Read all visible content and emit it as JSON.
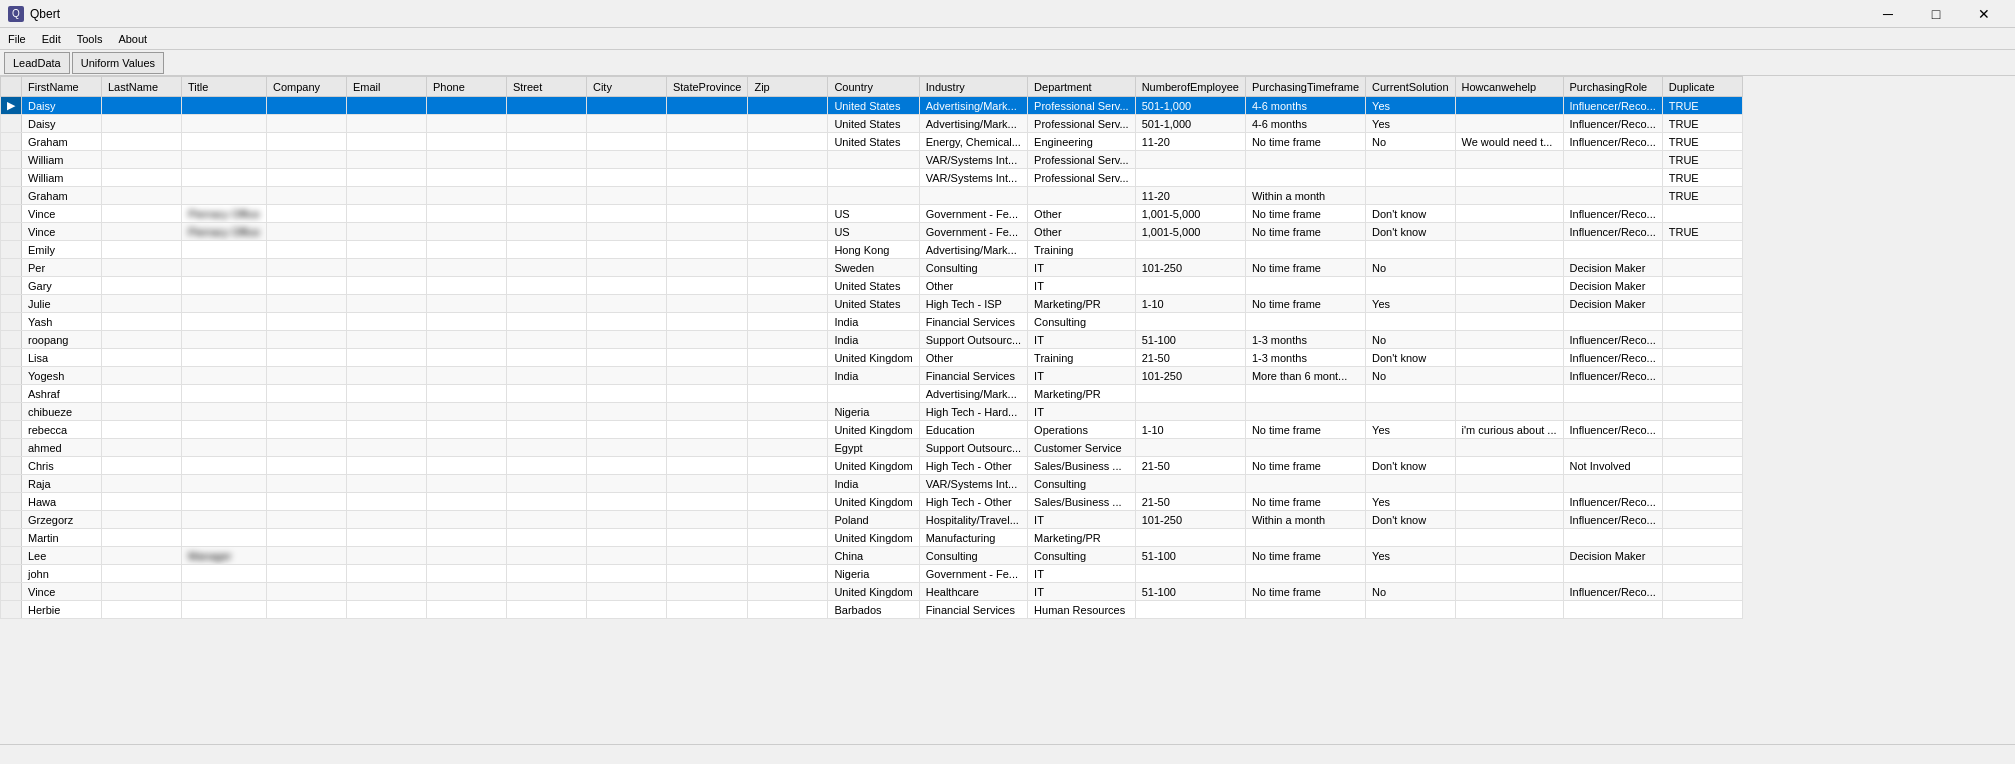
{
  "app": {
    "title": "Qbert",
    "icon": "Q"
  },
  "titlebar": {
    "minimize": "─",
    "maximize": "□",
    "close": "✕"
  },
  "menu": {
    "items": [
      "File",
      "Edit",
      "Tools",
      "About"
    ]
  },
  "toolbar": {
    "buttons": [
      "LeadData",
      "Uniform Values"
    ]
  },
  "table": {
    "columns": [
      "",
      "FirstName",
      "LastName",
      "Title",
      "Company",
      "Email",
      "Phone",
      "Street",
      "City",
      "StateProvince",
      "Zip",
      "Country",
      "Industry",
      "Department",
      "NumberofEmployee",
      "PurchasingTimeframe",
      "CurrentSolution",
      "Howcanwehelp",
      "PurchasingRole",
      "Duplicate"
    ],
    "rows": [
      {
        "sel": true,
        "indicator": "▶",
        "FirstName": "Daisy",
        "LastName": "",
        "Title": "",
        "Company": "",
        "Email": "",
        "Phone": "",
        "Street": "",
        "City": "",
        "StateProvince": "",
        "Zip": "",
        "Country": "United States",
        "Industry": "Advertising/Mark...",
        "Department": "Professional Serv...",
        "NumberofEmployee": "501-1,000",
        "PurchasingTimeframe": "4-6 months",
        "CurrentSolution": "Yes",
        "Howcanwehelp": "",
        "PurchasingRole": "Influencer/Reco...",
        "Duplicate": "TRUE"
      },
      {
        "indicator": "",
        "FirstName": "Daisy",
        "LastName": "",
        "Title": "",
        "Company": "",
        "Email": "",
        "Phone": "",
        "Street": "",
        "City": "",
        "StateProvince": "",
        "Zip": "",
        "Country": "United States",
        "Industry": "Advertising/Mark...",
        "Department": "Professional Serv...",
        "NumberofEmployee": "501-1,000",
        "PurchasingTimeframe": "4-6 months",
        "CurrentSolution": "Yes",
        "Howcanwehelp": "",
        "PurchasingRole": "Influencer/Reco...",
        "Duplicate": "TRUE"
      },
      {
        "indicator": "",
        "FirstName": "Graham",
        "LastName": "",
        "Title": "",
        "Company": "",
        "Email": "",
        "Phone": "",
        "Street": "",
        "City": "",
        "StateProvince": "",
        "Zip": "",
        "Country": "United States",
        "Industry": "Energy, Chemical...",
        "Department": "Engineering",
        "NumberofEmployee": "11-20",
        "PurchasingTimeframe": "No time frame",
        "CurrentSolution": "No",
        "Howcanwehelp": "We would need t...",
        "PurchasingRole": "Influencer/Reco...",
        "Duplicate": "TRUE"
      },
      {
        "indicator": "",
        "FirstName": "William",
        "LastName": "",
        "Title": "",
        "Company": "",
        "Email": "",
        "Phone": "",
        "Street": "",
        "City": "",
        "StateProvince": "",
        "Zip": "",
        "Country": "",
        "Industry": "VAR/Systems Int...",
        "Department": "Professional Serv...",
        "NumberofEmployee": "",
        "PurchasingTimeframe": "",
        "CurrentSolution": "",
        "Howcanwehelp": "",
        "PurchasingRole": "",
        "Duplicate": "TRUE"
      },
      {
        "indicator": "",
        "FirstName": "William",
        "LastName": "",
        "Title": "",
        "Company": "",
        "Email": "",
        "Phone": "",
        "Street": "",
        "City": "",
        "StateProvince": "",
        "Zip": "",
        "Country": "",
        "Industry": "VAR/Systems Int...",
        "Department": "Professional Serv...",
        "NumberofEmployee": "",
        "PurchasingTimeframe": "",
        "CurrentSolution": "",
        "Howcanwehelp": "",
        "PurchasingRole": "",
        "Duplicate": "TRUE"
      },
      {
        "indicator": "",
        "FirstName": "Graham",
        "LastName": "",
        "Title": "",
        "Company": "",
        "Email": "",
        "Phone": "",
        "Street": "",
        "City": "",
        "StateProvince": "",
        "Zip": "",
        "Country": "",
        "Industry": "",
        "Department": "",
        "NumberofEmployee": "11-20",
        "PurchasingTimeframe": "Within a month",
        "CurrentSolution": "",
        "Howcanwehelp": "",
        "PurchasingRole": "",
        "Duplicate": "TRUE"
      },
      {
        "indicator": "",
        "FirstName": "Vince",
        "LastName": "",
        "Title": "Pierracy Office",
        "Company": "",
        "Email": "",
        "Phone": "",
        "Street": "",
        "City": "",
        "StateProvince": "",
        "Zip": "",
        "Country": "US",
        "Industry": "Government - Fe...",
        "Department": "Other",
        "NumberofEmployee": "1,001-5,000",
        "PurchasingTimeframe": "No time frame",
        "CurrentSolution": "Don't know",
        "Howcanwehelp": "",
        "PurchasingRole": "Influencer/Reco...",
        "Duplicate": ""
      },
      {
        "indicator": "",
        "FirstName": "Vince",
        "LastName": "",
        "Title": "Pierracy Office",
        "Company": "",
        "Email": "",
        "Phone": "",
        "Street": "",
        "City": "",
        "StateProvince": "",
        "Zip": "",
        "Country": "US",
        "Industry": "Government - Fe...",
        "Department": "Other",
        "NumberofEmployee": "1,001-5,000",
        "PurchasingTimeframe": "No time frame",
        "CurrentSolution": "Don't know",
        "Howcanwehelp": "",
        "PurchasingRole": "Influencer/Reco...",
        "Duplicate": "TRUE"
      },
      {
        "indicator": "",
        "FirstName": "Emily",
        "LastName": "",
        "Title": "",
        "Company": "",
        "Email": "",
        "Phone": "",
        "Street": "",
        "City": "",
        "StateProvince": "",
        "Zip": "",
        "Country": "Hong Kong",
        "Industry": "Advertising/Mark...",
        "Department": "Training",
        "NumberofEmployee": "",
        "PurchasingTimeframe": "",
        "CurrentSolution": "",
        "Howcanwehelp": "",
        "PurchasingRole": "",
        "Duplicate": ""
      },
      {
        "indicator": "",
        "FirstName": "Per",
        "LastName": "",
        "Title": "",
        "Company": "",
        "Email": "",
        "Phone": "",
        "Street": "",
        "City": "",
        "StateProvince": "",
        "Zip": "",
        "Country": "Sweden",
        "Industry": "Consulting",
        "Department": "IT",
        "NumberofEmployee": "101-250",
        "PurchasingTimeframe": "No time frame",
        "CurrentSolution": "No",
        "Howcanwehelp": "",
        "PurchasingRole": "Decision Maker",
        "Duplicate": ""
      },
      {
        "indicator": "",
        "FirstName": "Gary",
        "LastName": "",
        "Title": "",
        "Company": "",
        "Email": "",
        "Phone": "",
        "Street": "",
        "City": "",
        "StateProvince": "",
        "Zip": "",
        "Country": "United States",
        "Industry": "Other",
        "Department": "IT",
        "NumberofEmployee": "",
        "PurchasingTimeframe": "",
        "CurrentSolution": "",
        "Howcanwehelp": "",
        "PurchasingRole": "Decision Maker",
        "Duplicate": ""
      },
      {
        "indicator": "",
        "FirstName": "Julie",
        "LastName": "",
        "Title": "",
        "Company": "",
        "Email": "",
        "Phone": "",
        "Street": "",
        "City": "",
        "StateProvince": "",
        "Zip": "",
        "Country": "United States",
        "Industry": "High Tech - ISP",
        "Department": "Marketing/PR",
        "NumberofEmployee": "1-10",
        "PurchasingTimeframe": "No time frame",
        "CurrentSolution": "Yes",
        "Howcanwehelp": "",
        "PurchasingRole": "Decision Maker",
        "Duplicate": ""
      },
      {
        "indicator": "",
        "FirstName": "Yash",
        "LastName": "",
        "Title": "",
        "Company": "",
        "Email": "",
        "Phone": "",
        "Street": "",
        "City": "",
        "StateProvince": "",
        "Zip": "",
        "Country": "India",
        "Industry": "Financial Services",
        "Department": "Consulting",
        "NumberofEmployee": "",
        "PurchasingTimeframe": "",
        "CurrentSolution": "",
        "Howcanwehelp": "",
        "PurchasingRole": "",
        "Duplicate": ""
      },
      {
        "indicator": "",
        "FirstName": "roopang",
        "LastName": "",
        "Title": "",
        "Company": "",
        "Email": "",
        "Phone": "",
        "Street": "",
        "City": "",
        "StateProvince": "",
        "Zip": "",
        "Country": "India",
        "Industry": "Support Outsourc...",
        "Department": "IT",
        "NumberofEmployee": "51-100",
        "PurchasingTimeframe": "1-3 months",
        "CurrentSolution": "No",
        "Howcanwehelp": "",
        "PurchasingRole": "Influencer/Reco...",
        "Duplicate": ""
      },
      {
        "indicator": "",
        "FirstName": "Lisa",
        "LastName": "",
        "Title": "",
        "Company": "",
        "Email": "",
        "Phone": "",
        "Street": "",
        "City": "",
        "StateProvince": "",
        "Zip": "",
        "Country": "United Kingdom",
        "Industry": "Other",
        "Department": "Training",
        "NumberofEmployee": "21-50",
        "PurchasingTimeframe": "1-3 months",
        "CurrentSolution": "Don't know",
        "Howcanwehelp": "",
        "PurchasingRole": "Influencer/Reco...",
        "Duplicate": ""
      },
      {
        "indicator": "",
        "FirstName": "Yogesh",
        "LastName": "",
        "Title": "",
        "Company": "",
        "Email": "",
        "Phone": "",
        "Street": "",
        "City": "",
        "StateProvince": "",
        "Zip": "",
        "Country": "India",
        "Industry": "Financial Services",
        "Department": "IT",
        "NumberofEmployee": "101-250",
        "PurchasingTimeframe": "More than 6 mont...",
        "CurrentSolution": "No",
        "Howcanwehelp": "",
        "PurchasingRole": "Influencer/Reco...",
        "Duplicate": ""
      },
      {
        "indicator": "",
        "FirstName": "Ashraf",
        "LastName": "",
        "Title": "",
        "Company": "",
        "Email": "",
        "Phone": "",
        "Street": "",
        "City": "",
        "StateProvince": "",
        "Zip": "",
        "Country": "",
        "Industry": "Advertising/Mark...",
        "Department": "Marketing/PR",
        "NumberofEmployee": "",
        "PurchasingTimeframe": "",
        "CurrentSolution": "",
        "Howcanwehelp": "",
        "PurchasingRole": "",
        "Duplicate": ""
      },
      {
        "indicator": "",
        "FirstName": "chibueze",
        "LastName": "",
        "Title": "",
        "Company": "",
        "Email": "",
        "Phone": "",
        "Street": "",
        "City": "",
        "StateProvince": "",
        "Zip": "",
        "Country": "Nigeria",
        "Industry": "High Tech - Hard...",
        "Department": "IT",
        "NumberofEmployee": "",
        "PurchasingTimeframe": "",
        "CurrentSolution": "",
        "Howcanwehelp": "",
        "PurchasingRole": "",
        "Duplicate": ""
      },
      {
        "indicator": "",
        "FirstName": "rebecca",
        "LastName": "",
        "Title": "",
        "Company": "",
        "Email": "",
        "Phone": "",
        "Street": "",
        "City": "",
        "StateProvince": "",
        "Zip": "",
        "Country": "United Kingdom",
        "Industry": "Education",
        "Department": "Operations",
        "NumberofEmployee": "1-10",
        "PurchasingTimeframe": "No time frame",
        "CurrentSolution": "Yes",
        "Howcanwehelp": "i'm curious about ...",
        "PurchasingRole": "Influencer/Reco...",
        "Duplicate": ""
      },
      {
        "indicator": "",
        "FirstName": "ahmed",
        "LastName": "",
        "Title": "",
        "Company": "",
        "Email": "",
        "Phone": "",
        "Street": "",
        "City": "",
        "StateProvince": "",
        "Zip": "",
        "Country": "Egypt",
        "Industry": "Support Outsourc...",
        "Department": "Customer Service",
        "NumberofEmployee": "",
        "PurchasingTimeframe": "",
        "CurrentSolution": "",
        "Howcanwehelp": "",
        "PurchasingRole": "",
        "Duplicate": ""
      },
      {
        "indicator": "",
        "FirstName": "Chris",
        "LastName": "",
        "Title": "",
        "Company": "",
        "Email": "",
        "Phone": "",
        "Street": "",
        "City": "",
        "StateProvince": "",
        "Zip": "",
        "Country": "United Kingdom",
        "Industry": "High Tech - Other",
        "Department": "Sales/Business ...",
        "NumberofEmployee": "21-50",
        "PurchasingTimeframe": "No time frame",
        "CurrentSolution": "Don't know",
        "Howcanwehelp": "",
        "PurchasingRole": "Not Involved",
        "Duplicate": ""
      },
      {
        "indicator": "",
        "FirstName": "Raja",
        "LastName": "",
        "Title": "",
        "Company": "",
        "Email": "",
        "Phone": "",
        "Street": "",
        "City": "",
        "StateProvince": "",
        "Zip": "",
        "Country": "India",
        "Industry": "VAR/Systems Int...",
        "Department": "Consulting",
        "NumberofEmployee": "",
        "PurchasingTimeframe": "",
        "CurrentSolution": "",
        "Howcanwehelp": "",
        "PurchasingRole": "",
        "Duplicate": ""
      },
      {
        "indicator": "",
        "FirstName": "Hawa",
        "LastName": "",
        "Title": "",
        "Company": "",
        "Email": "",
        "Phone": "",
        "Street": "",
        "City": "",
        "StateProvince": "",
        "Zip": "",
        "Country": "United Kingdom",
        "Industry": "High Tech - Other",
        "Department": "Sales/Business ...",
        "NumberofEmployee": "21-50",
        "PurchasingTimeframe": "No time frame",
        "CurrentSolution": "Yes",
        "Howcanwehelp": "",
        "PurchasingRole": "Influencer/Reco...",
        "Duplicate": ""
      },
      {
        "indicator": "",
        "FirstName": "Grzegorz",
        "LastName": "",
        "Title": "",
        "Company": "",
        "Email": "",
        "Phone": "",
        "Street": "",
        "City": "",
        "StateProvince": "",
        "Zip": "",
        "Country": "Poland",
        "Industry": "Hospitality/Travel...",
        "Department": "IT",
        "NumberofEmployee": "101-250",
        "PurchasingTimeframe": "Within a month",
        "CurrentSolution": "Don't know",
        "Howcanwehelp": "",
        "PurchasingRole": "Influencer/Reco...",
        "Duplicate": ""
      },
      {
        "indicator": "",
        "FirstName": "Martin",
        "LastName": "",
        "Title": "",
        "Company": "",
        "Email": "",
        "Phone": "",
        "Street": "",
        "City": "",
        "StateProvince": "",
        "Zip": "",
        "Country": "United Kingdom",
        "Industry": "Manufacturing",
        "Department": "Marketing/PR",
        "NumberofEmployee": "",
        "PurchasingTimeframe": "",
        "CurrentSolution": "",
        "Howcanwehelp": "",
        "PurchasingRole": "",
        "Duplicate": ""
      },
      {
        "indicator": "",
        "FirstName": "Lee",
        "LastName": "",
        "Title": "Manager",
        "Company": "",
        "Email": "",
        "Phone": "",
        "Street": "",
        "City": "",
        "StateProvince": "",
        "Zip": "",
        "Country": "China",
        "Industry": "Consulting",
        "Department": "Consulting",
        "NumberofEmployee": "51-100",
        "PurchasingTimeframe": "No time frame",
        "CurrentSolution": "Yes",
        "Howcanwehelp": "",
        "PurchasingRole": "Decision Maker",
        "Duplicate": ""
      },
      {
        "indicator": "",
        "FirstName": "john",
        "LastName": "",
        "Title": "",
        "Company": "",
        "Email": "",
        "Phone": "",
        "Street": "",
        "City": "",
        "StateProvince": "",
        "Zip": "",
        "Country": "Nigeria",
        "Industry": "Government - Fe...",
        "Department": "IT",
        "NumberofEmployee": "",
        "PurchasingTimeframe": "",
        "CurrentSolution": "",
        "Howcanwehelp": "",
        "PurchasingRole": "",
        "Duplicate": ""
      },
      {
        "indicator": "",
        "FirstName": "Vince",
        "LastName": "",
        "Title": "",
        "Company": "",
        "Email": "",
        "Phone": "",
        "Street": "",
        "City": "",
        "StateProvince": "",
        "Zip": "",
        "Country": "United Kingdom",
        "Industry": "Healthcare",
        "Department": "IT",
        "NumberofEmployee": "51-100",
        "PurchasingTimeframe": "No time frame",
        "CurrentSolution": "No",
        "Howcanwehelp": "",
        "PurchasingRole": "Influencer/Reco...",
        "Duplicate": ""
      },
      {
        "indicator": "",
        "FirstName": "Herbie",
        "LastName": "",
        "Title": "",
        "Company": "",
        "Email": "",
        "Phone": "",
        "Street": "",
        "City": "",
        "StateProvince": "",
        "Zip": "",
        "Country": "Barbados",
        "Industry": "Financial Services",
        "Department": "Human Resources",
        "NumberofEmployee": "",
        "PurchasingTimeframe": "",
        "CurrentSolution": "",
        "Howcanwehelp": "",
        "PurchasingRole": "",
        "Duplicate": ""
      }
    ]
  }
}
